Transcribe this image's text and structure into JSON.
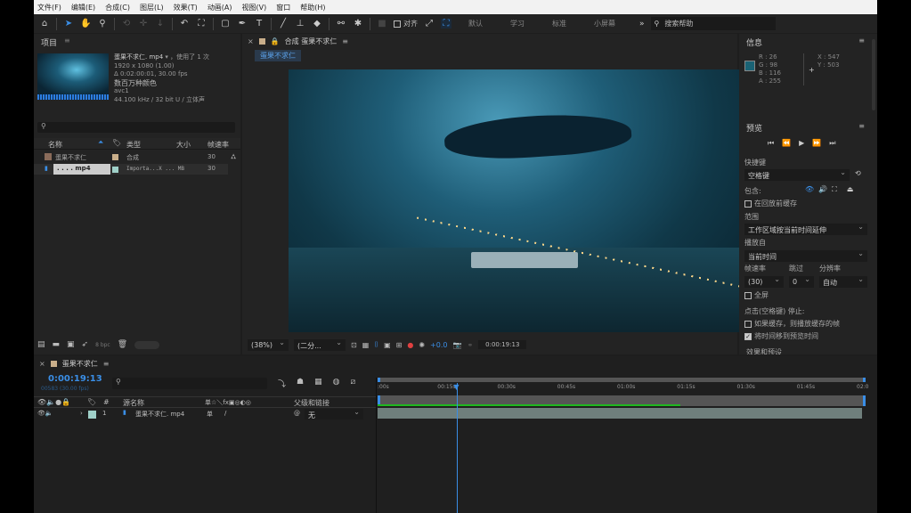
{
  "menu": [
    "文件(F)",
    "编辑(E)",
    "合成(C)",
    "图层(L)",
    "效果(T)",
    "动画(A)",
    "视图(V)",
    "窗口",
    "帮助(H)"
  ],
  "toolbar": {
    "snap_label": "对齐",
    "workspaces": [
      "默认",
      "学习",
      "标准",
      "小屏幕"
    ],
    "more": "»",
    "search_placeholder": "搜索帮助"
  },
  "project": {
    "title": "项目",
    "file_name": "蛋果不求仁. mp4",
    "used": "，使用了 1 次",
    "resolution": "1920 x 1080 (1.00)",
    "duration": "Δ 0:02:00:01, 30.00 fps",
    "colors": "数百万种颜色",
    "codec": "avc1",
    "audio": "44.100 kHz / 32 bit U / 立体声",
    "columns": [
      "名称",
      "类型",
      "大小",
      "帧速率"
    ],
    "items": [
      {
        "name": "蛋果不求仁",
        "type": "合成",
        "size": "",
        "fps": "30",
        "color": "#c9ae8a"
      },
      {
        "name": ". . . . mp4",
        "type": "Importa...X ... MB",
        "size": "",
        "fps": "30",
        "color": "#9fd0c8"
      }
    ],
    "bpc": "8 bpc"
  },
  "comp": {
    "tab_title": "合成 蛋果不求仁",
    "sub_tab": "蛋果不求仁",
    "zoom": "(38%)",
    "resolution": "(二分...",
    "exposure": "+0.0",
    "timecode": "0:00:19:13"
  },
  "info": {
    "title": "信息",
    "r": "R : 26",
    "g": "G : 98",
    "b": "B : 116",
    "a": "A : 255",
    "x": "X : 547",
    "y": "Y : 503",
    "swatch": "#1a6274"
  },
  "preview": {
    "title": "预览",
    "shortcut_label": "快捷键",
    "shortcut": "空格键",
    "include_label": "包含:",
    "cache_before": "在回放前缓存",
    "range_label": "范围",
    "range": "工作区域按当前时间延伸",
    "play_from_label": "播放自",
    "play_from": "当前时间",
    "fps_label": "帧速率",
    "skip_label": "跳过",
    "res_label": "分辨率",
    "fps": "(30)",
    "skip": "0",
    "res": "自动",
    "fullscreen": "全屏",
    "stop_label": "点击(空格键) 停止:",
    "if_cached": "如果缓存，则播放缓存的帧",
    "move_time": "将时间移到预览时间",
    "cut": "效果和预设"
  },
  "timeline": {
    "tab": "蛋果不求仁",
    "timecode": "0:00:19:13",
    "frames": "00583 (30.00 fps)",
    "col_source": "源名称",
    "col_switches": "单☆＼fx▣◎◐◎",
    "col_parent": "父级和链接",
    "layer": {
      "index": "1",
      "name": "蛋果不求仁. mp4",
      "parent": "无",
      "color": "#9fd0c8"
    },
    "ruler": [
      ":00s",
      "00:15s",
      "00:30s",
      "00:45s",
      "01:00s",
      "01:15s",
      "01:30s",
      "01:45s",
      "02:0"
    ],
    "playhead_fraction": 0.163,
    "work_area_fraction": 0.62
  }
}
